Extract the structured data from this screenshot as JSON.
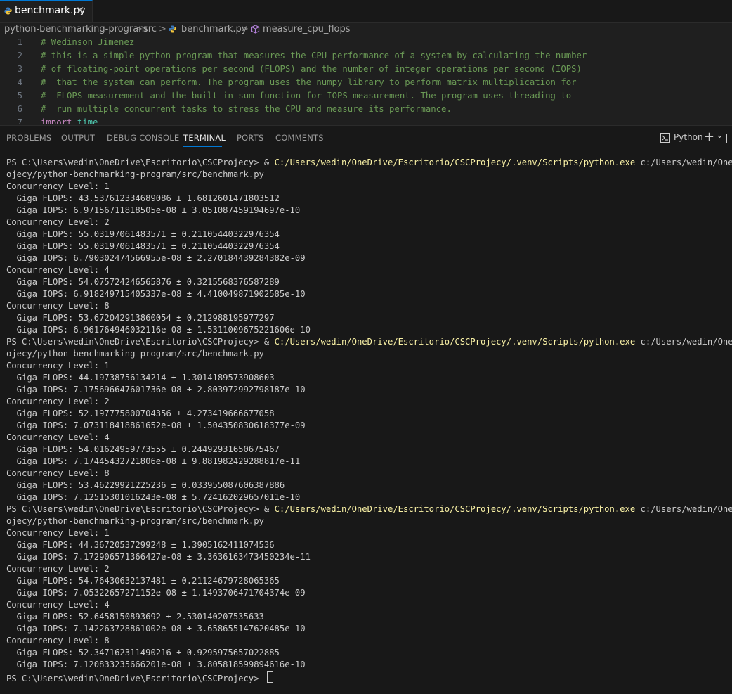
{
  "tab": {
    "label": "benchmark.py",
    "close": "✕"
  },
  "breadcrumb": {
    "folder": "python-benchmarking-program",
    "sep1": ">",
    "src": "src",
    "sep2": ">",
    "file": "benchmark.py",
    "sep3": ">",
    "symbol": "measure_cpu_flops"
  },
  "editor": {
    "lines": [
      {
        "n": "1",
        "text": "# Wedinson Jimenez"
      },
      {
        "n": "2",
        "text": "# this is a simple python program that measures the CPU performance of a system by calculating the number"
      },
      {
        "n": "3",
        "text": "# of floating-point operations per second (FLOPS) and the number of integer operations per second (IOPS)"
      },
      {
        "n": "4",
        "text": "#  that the system can perform. The program uses the numpy library to perform matrix multiplication for"
      },
      {
        "n": "5",
        "text": "#  FLOPS measurement and the built-in sum function for IOPS measurement. The program uses threading to"
      },
      {
        "n": "6",
        "text": "#  run multiple concurrent tasks to stress the CPU and measure its performance."
      },
      {
        "n": "7",
        "kw": "import",
        "id": "time"
      }
    ]
  },
  "panel": {
    "tabs": [
      "PROBLEMS",
      "OUTPUT",
      "DEBUG CONSOLE",
      "TERMINAL",
      "PORTS",
      "COMMENTS"
    ],
    "shell": "Python",
    "add": "+",
    "chevron": "⌄"
  },
  "terminal": {
    "prompt": "PS C:\\Users\\wedin\\OneDrive\\Escritorio\\CSCProjecy> ",
    "amp": "& ",
    "python_path": "C:/Users/wedin/OneDrive/Escritorio/CSCProjecy/.venv/Scripts/python.exe",
    "arg_start": " c:/Users/wedin/OneDrive/E",
    "arg_cont": "ojecy/python-benchmarking-program/src/benchmark.py",
    "runs": [
      [
        "Concurrency Level: 1",
        "  Giga FLOPS: 43.537612334689086 ± 1.6812601471803512",
        "  Giga IOPS: 6.97156711818505e-08 ± 3.051087459194697e-10",
        "Concurrency Level: 2",
        "  Giga FLOPS: 55.03197061483571 ± 0.21105440322976354",
        "  Giga FLOPS: 55.03197061483571 ± 0.21105440322976354",
        "  Giga IOPS: 6.790302474566955e-08 ± 2.270184439284382e-09",
        "Concurrency Level: 4",
        "  Giga FLOPS: 54.075724246565876 ± 0.3215568376587289",
        "  Giga IOPS: 6.918249715405337e-08 ± 4.410049871902585e-10",
        "Concurrency Level: 8",
        "  Giga FLOPS: 53.672042913860054 ± 0.212988195977297",
        "  Giga IOPS: 6.961764946032116e-08 ± 1.5311009675221606e-10"
      ],
      [
        "Concurrency Level: 1",
        "  Giga FLOPS: 44.19738756134214 ± 1.3014189573908603",
        "  Giga IOPS: 7.175696647601736e-08 ± 2.803972992798187e-10",
        "Concurrency Level: 2",
        "  Giga FLOPS: 52.197775800704356 ± 4.273419666677058",
        "  Giga IOPS: 7.073118418861652e-08 ± 1.504350830618377e-09",
        "Concurrency Level: 4",
        "  Giga FLOPS: 54.01624959773555 ± 0.24492931650675467",
        "  Giga IOPS: 7.17445432721806e-08 ± 9.881982429288817e-11",
        "Concurrency Level: 8",
        "  Giga FLOPS: 53.46229921225236 ± 0.033955087606387886",
        "  Giga IOPS: 7.12515301016243e-08 ± 5.724162029657011e-10"
      ],
      [
        "Concurrency Level: 1",
        "  Giga FLOPS: 44.36720537299248 ± 1.3905162411074536",
        "  Giga IOPS: 7.172906571366427e-08 ± 3.3636163473450234e-11",
        "Concurrency Level: 2",
        "  Giga FLOPS: 54.76430632137481 ± 0.21124679728065365",
        "  Giga IOPS: 7.05322657271152e-08 ± 1.1493706471704374e-09",
        "Concurrency Level: 4",
        "  Giga FLOPS: 52.6458150893692 ± 2.530140207535633",
        "  Giga IOPS: 7.142263728861002e-08 ± 3.658655147620485e-10",
        "Concurrency Level: 8",
        "  Giga FLOPS: 52.347162311490216 ± 0.9295975657022885",
        "  Giga IOPS: 7.120833235666201e-08 ± 3.805818599894616e-10"
      ]
    ]
  }
}
